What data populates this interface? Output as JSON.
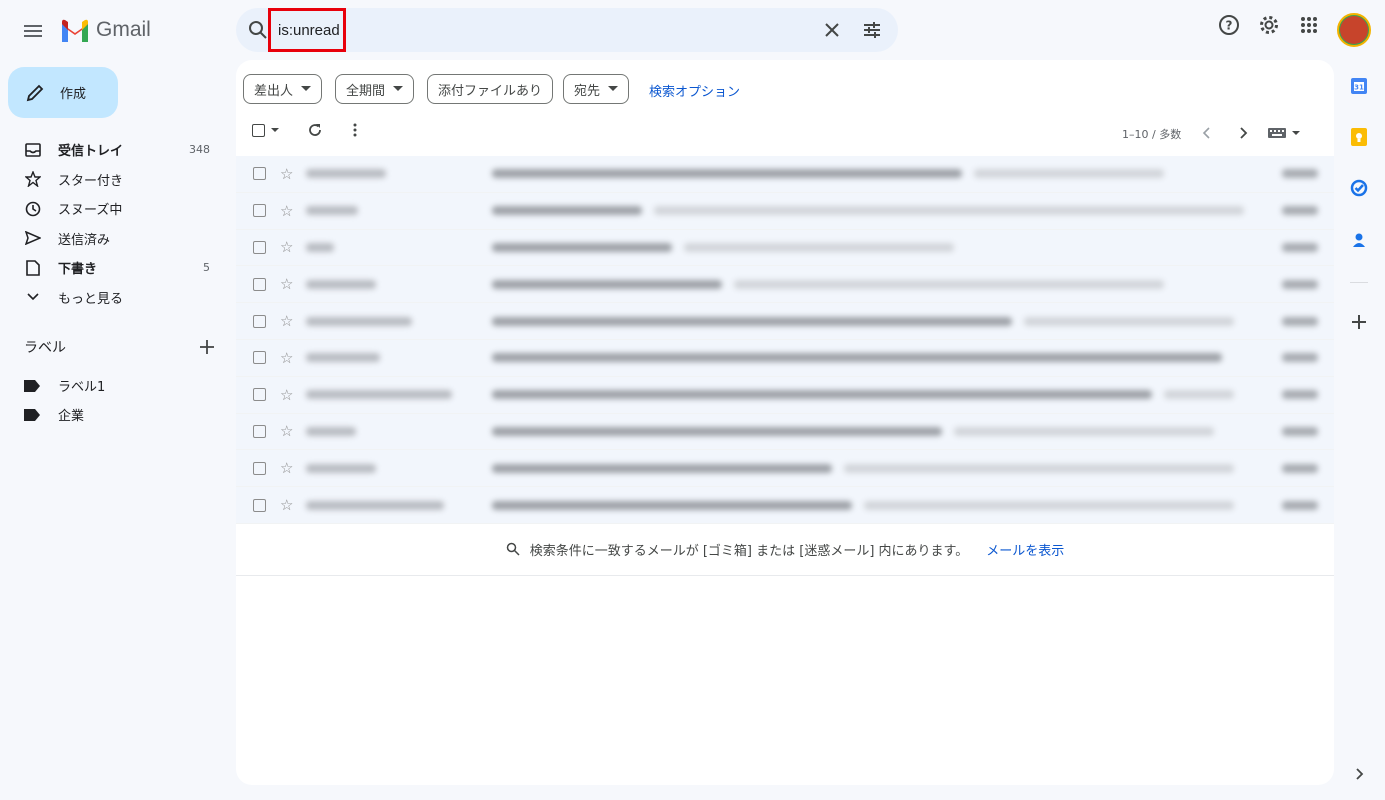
{
  "app": {
    "logo_text": "Gmail"
  },
  "search": {
    "query": "is:unread"
  },
  "compose": {
    "label": "作成"
  },
  "nav": [
    {
      "label": "受信トレイ",
      "count": "348",
      "icon": "inbox-icon",
      "bold": true
    },
    {
      "label": "スター付き",
      "count": "",
      "icon": "star-icon",
      "bold": false
    },
    {
      "label": "スヌーズ中",
      "count": "",
      "icon": "clock-icon",
      "bold": false
    },
    {
      "label": "送信済み",
      "count": "",
      "icon": "send-icon",
      "bold": false
    },
    {
      "label": "下書き",
      "count": "5",
      "icon": "draft-icon",
      "bold": true
    },
    {
      "label": "もっと見る",
      "count": "",
      "icon": "chevron-down-icon",
      "bold": false
    }
  ],
  "labels": {
    "heading": "ラベル",
    "items": [
      "ラベル1",
      "企業"
    ]
  },
  "filters": {
    "from": "差出人",
    "period": "全期間",
    "has_attachment": "添付ファイルあり",
    "to": "宛先",
    "search_options": "検索オプション"
  },
  "pagination": {
    "text": "1–10 / 多数"
  },
  "emails": {
    "row_count": 10,
    "content_blurred": true
  },
  "notice": {
    "text": "検索条件に一致するメールが [ゴミ箱] または [迷惑メール] 内にあります。",
    "link": "メールを表示"
  },
  "colors": {
    "background": "#f6f8fc",
    "search_bg": "#eaf1fb",
    "compose_bg": "#c2e7ff",
    "highlight_box": "#e8000b",
    "link": "#0b57d0"
  }
}
